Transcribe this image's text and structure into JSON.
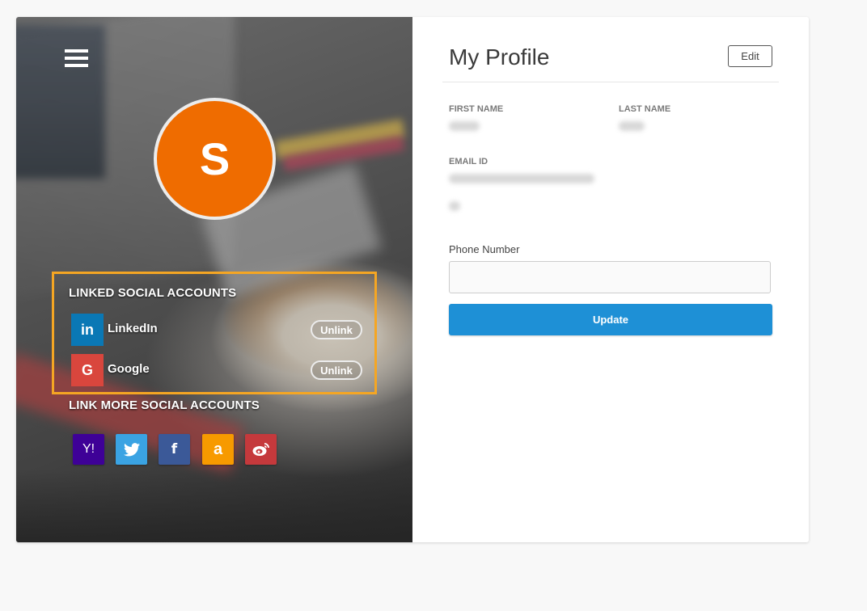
{
  "left_panel": {
    "avatar_initial": "S",
    "avatar_color": "#ef6c00",
    "linked_title": "LINKED SOCIAL ACCOUNTS",
    "linked_accounts": [
      {
        "name": "LinkedIn",
        "icon": "linkedin-icon",
        "glyph": "in",
        "color": "#0a78b5",
        "action_label": "Unlink"
      },
      {
        "name": "Google",
        "icon": "google-icon",
        "glyph": "G",
        "color": "#d9463d",
        "action_label": "Unlink"
      }
    ],
    "link_more_title": "LINK MORE SOCIAL ACCOUNTS",
    "social_buttons": [
      {
        "icon": "yahoo-icon",
        "glyph": "Y!",
        "color": "#3e0197"
      },
      {
        "icon": "twitter-icon",
        "glyph": "🐦",
        "color": "#3aa3e3"
      },
      {
        "icon": "facebook-icon",
        "glyph": "f",
        "color": "#3b5998"
      },
      {
        "icon": "amazon-icon",
        "glyph": "a",
        "color": "#f79a00"
      },
      {
        "icon": "weibo-icon",
        "glyph": "◉",
        "color": "#c5393c"
      }
    ],
    "highlight_color": "#f5a623"
  },
  "profile": {
    "title": "My Profile",
    "edit_label": "Edit",
    "first_name_label": "FIRST NAME",
    "last_name_label": "LAST NAME",
    "email_label": "EMAIL ID",
    "phone_label": "Phone Number",
    "phone_value": "",
    "update_label": "Update",
    "accent": "#1e90d6"
  }
}
